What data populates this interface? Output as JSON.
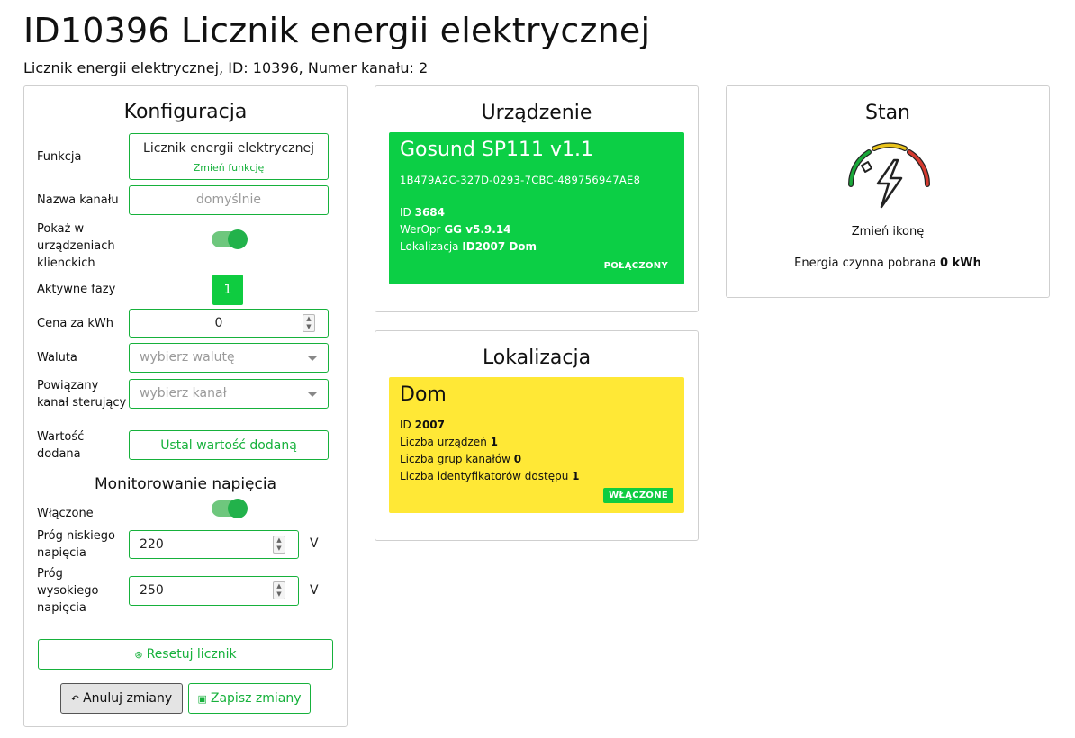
{
  "page": {
    "title": "ID10396 Licznik energii elektrycznej",
    "subtitle": "Licznik energii elektrycznej, ID: 10396, Numer kanału: 2"
  },
  "config": {
    "title": "Konfiguracja",
    "function_label": "Funkcja",
    "function_value": "Licznik energii elektrycznej",
    "function_change": "Zmień funkcję",
    "channel_name_label": "Nazwa kanału",
    "channel_name_placeholder": "domyślnie",
    "show_in_clients_label": "Pokaż w urządzeniach klienckich",
    "show_in_clients": true,
    "active_phases_label": "Aktywne fazy",
    "active_phase": "1",
    "price_label": "Cena za kWh",
    "price_value": "0",
    "currency_label": "Waluta",
    "currency_placeholder": "wybierz walutę",
    "linked_channel_label": "Powiązany kanał sterujący",
    "linked_channel_placeholder": "wybierz kanał",
    "added_value_label": "Wartość dodana",
    "added_value_button": "Ustal wartość dodaną",
    "voltage_title": "Monitorowanie napięcia",
    "enabled_label": "Włączone",
    "enabled": true,
    "low_threshold_label": "Próg niskiego napięcia",
    "low_threshold_value": "220",
    "high_threshold_label": "Próg wysokiego napięcia",
    "high_threshold_value": "250",
    "unit": "V",
    "reset_button": "Resetuj licznik",
    "cancel_button": "Anuluj zmiany",
    "save_button": "Zapisz zmiany"
  },
  "device": {
    "title": "Urządzenie",
    "name": "Gosund SP111 v1.1",
    "guid": "1B479A2C-327D-0293-7CBC-489756947AE8",
    "id_label": "ID",
    "id_value": "3684",
    "firmware_label": "WerOpr",
    "firmware_value": "GG v5.9.14",
    "location_label": "Lokalizacja",
    "location_value": "ID2007 Dom",
    "status": "POŁĄCZONY",
    "card_color": "#0ccf45"
  },
  "location": {
    "title": "Lokalizacja",
    "name": "Dom",
    "id_label": "ID",
    "id_value": "2007",
    "devices_label": "Liczba urządzeń",
    "devices_value": "1",
    "groups_label": "Liczba grup kanałów",
    "groups_value": "0",
    "access_label": "Liczba identyfikatorów dostępu",
    "access_value": "1",
    "status": "WŁĄCZONE",
    "card_color": "#ffe836"
  },
  "state": {
    "title": "Stan",
    "icon": "energy-meter-gauge-icon",
    "change_icon": "Zmień ikonę",
    "energy_label": "Energia czynna pobrana",
    "energy_value": "0 kWh"
  },
  "colors": {
    "accent": "#16b13b",
    "badge": "#0fcc40"
  }
}
